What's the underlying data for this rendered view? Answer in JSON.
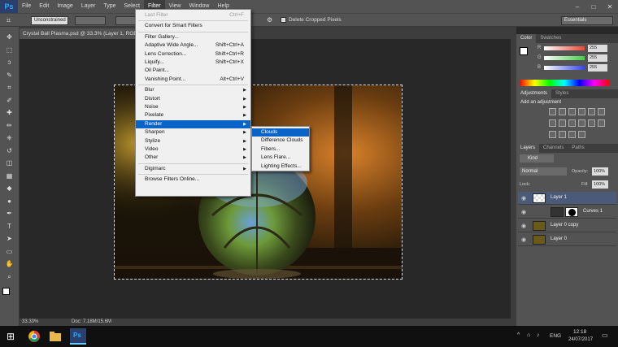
{
  "app": {
    "logo": "Ps"
  },
  "menubar": {
    "items": [
      "File",
      "Edit",
      "Image",
      "Layer",
      "Type",
      "Select",
      "Filter",
      "View",
      "Window",
      "Help"
    ],
    "active": "Filter"
  },
  "window_controls": {
    "minimize": "–",
    "maximize": "□",
    "close": "✕"
  },
  "options": {
    "style_value": "Unconstrained",
    "delete_cropped": "Delete Cropped Pixels",
    "workspace": "Essentials"
  },
  "document": {
    "tab_title": "Crystal Ball Plasma.psd @ 33.3% (Layer 1, RGB/8)",
    "zoom": "33.33%",
    "doc_size": "Doc: 7.18M/15.6M"
  },
  "filter_menu": {
    "items": [
      {
        "label": "Last Filter",
        "shortcut": "Ctrl+F",
        "disabled": true
      },
      {
        "sep": true
      },
      {
        "label": "Convert for Smart Filters"
      },
      {
        "sep": true
      },
      {
        "label": "Filter Gallery..."
      },
      {
        "label": "Adaptive Wide Angle...",
        "shortcut": "Shift+Ctrl+A"
      },
      {
        "label": "Lens Correction...",
        "shortcut": "Shift+Ctrl+R"
      },
      {
        "label": "Liquify...",
        "shortcut": "Shift+Ctrl+X"
      },
      {
        "label": "Oil Paint..."
      },
      {
        "label": "Vanishing Point...",
        "shortcut": "Alt+Ctrl+V"
      },
      {
        "sep": true
      },
      {
        "label": "Blur",
        "sub": true
      },
      {
        "label": "Distort",
        "sub": true
      },
      {
        "label": "Noise",
        "sub": true
      },
      {
        "label": "Pixelate",
        "sub": true
      },
      {
        "label": "Render",
        "sub": true,
        "highlight": true
      },
      {
        "label": "Sharpen",
        "sub": true
      },
      {
        "label": "Stylize",
        "sub": true
      },
      {
        "label": "Video",
        "sub": true
      },
      {
        "label": "Other",
        "sub": true
      },
      {
        "sep": true
      },
      {
        "label": "Digimarc",
        "sub": true
      },
      {
        "sep": true
      },
      {
        "label": "Browse Filters Online..."
      }
    ]
  },
  "render_submenu": {
    "items": [
      {
        "label": "Clouds",
        "highlight": true
      },
      {
        "label": "Difference Clouds"
      },
      {
        "label": "Fibers..."
      },
      {
        "label": "Lens Flare..."
      },
      {
        "label": "Lighting Effects..."
      }
    ]
  },
  "color_panel": {
    "tabs": [
      "Color",
      "Swatches"
    ],
    "sliders": [
      {
        "label": "R",
        "value": "255",
        "color": "#e43"
      },
      {
        "label": "G",
        "value": "255",
        "color": "#4c4"
      },
      {
        "label": "B",
        "value": "255",
        "color": "#34e"
      }
    ]
  },
  "adjustments_panel": {
    "tabs": [
      "Adjustments",
      "Styles"
    ],
    "heading": "Add an adjustment"
  },
  "layers_panel": {
    "tabs": [
      "Layers",
      "Channels",
      "Paths"
    ],
    "kind": "Kind",
    "blend": "Normal",
    "opacity_label": "Opacity:",
    "opacity": "100%",
    "lock_label": "Lock:",
    "fill_label": "Fill:",
    "fill": "100%",
    "layers": [
      {
        "name": "Layer 1",
        "selected": true
      },
      {
        "name": "Curves 1"
      },
      {
        "name": "Layer 0 copy"
      },
      {
        "name": "Layer 0"
      }
    ]
  },
  "taskbar": {
    "language": "ENG",
    "time": "12:18",
    "date": "24/07/2017"
  }
}
